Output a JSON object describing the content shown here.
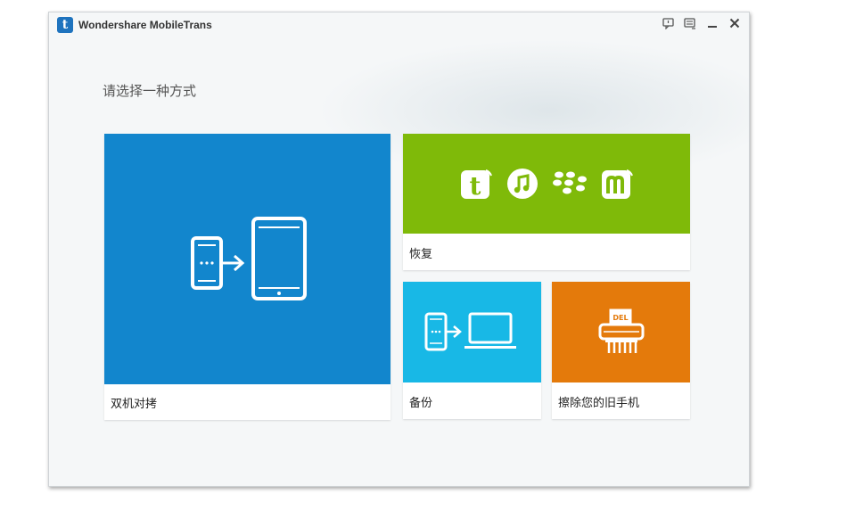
{
  "window": {
    "title": "Wondershare MobileTrans",
    "logo_letter": "t",
    "controls": [
      "feedback-icon",
      "menu-icon",
      "minimize-icon",
      "close-icon"
    ]
  },
  "prompt": "请选择一种方式",
  "tiles": {
    "phone_transfer": {
      "label": "双机对拷",
      "color": "#1286cd",
      "icon": "phone-to-tablet-icon"
    },
    "restore": {
      "label": "恢复",
      "color": "#7fba09",
      "icons": [
        "mobiletrans-icon",
        "itunes-icon",
        "blackberry-icon",
        "mobilego-icon"
      ]
    },
    "backup": {
      "label": "备份",
      "color": "#18b8e6",
      "icon": "phone-to-laptop-icon"
    },
    "erase": {
      "label": "擦除您的旧手机",
      "color": "#e47a0b",
      "icon": "shredder-icon",
      "icon_text": "DEL"
    }
  }
}
